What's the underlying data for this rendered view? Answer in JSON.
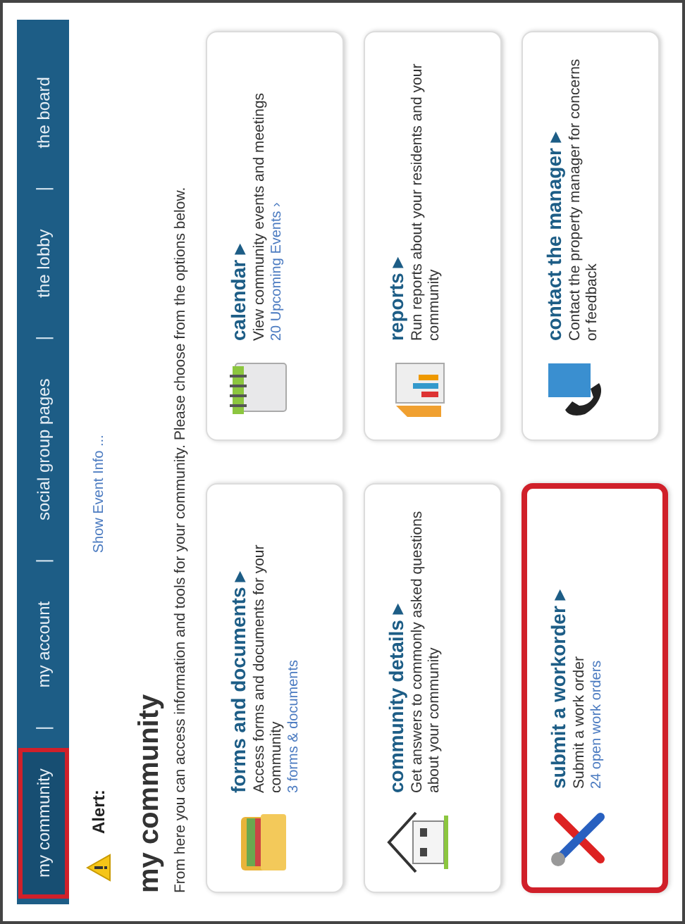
{
  "nav": {
    "tabs": [
      {
        "label": "my community",
        "selected": true,
        "highlighted": true
      },
      {
        "label": "my account",
        "selected": false,
        "highlighted": false
      },
      {
        "label": "social group pages",
        "selected": false,
        "highlighted": false
      },
      {
        "label": "the lobby",
        "selected": false,
        "highlighted": false
      },
      {
        "label": "the board",
        "selected": false,
        "highlighted": false
      }
    ],
    "separator": "|"
  },
  "alert": {
    "label": "Alert:",
    "link": "Show Event Info ..."
  },
  "heading": "my community",
  "intro": "From here you can access information and tools for your community. Please choose from the options below.",
  "cards": [
    {
      "kind": "folder",
      "title": "forms and documents ▸",
      "text": "Access forms and documents for your community",
      "link": "3 forms & documents",
      "highlighted": false
    },
    {
      "kind": "calendar",
      "title": "calendar ▸",
      "text": "View community events and meetings",
      "link": "20 Upcoming Events ›",
      "highlighted": false
    },
    {
      "kind": "house",
      "title": "community details ▸",
      "text": "Get answers to commonly asked questions about your community",
      "highlighted": false
    },
    {
      "kind": "chart",
      "title": "reports ▸",
      "text": "Run reports about your residents and your community",
      "highlighted": false
    },
    {
      "kind": "tools",
      "title": "submit a workorder ▸",
      "text": "Submit a work order",
      "link": "24 open work orders",
      "highlighted": true
    },
    {
      "kind": "phone",
      "title": "contact the manager ▸",
      "text": "Contact the property manager for concerns or feedback",
      "highlighted": false
    }
  ]
}
